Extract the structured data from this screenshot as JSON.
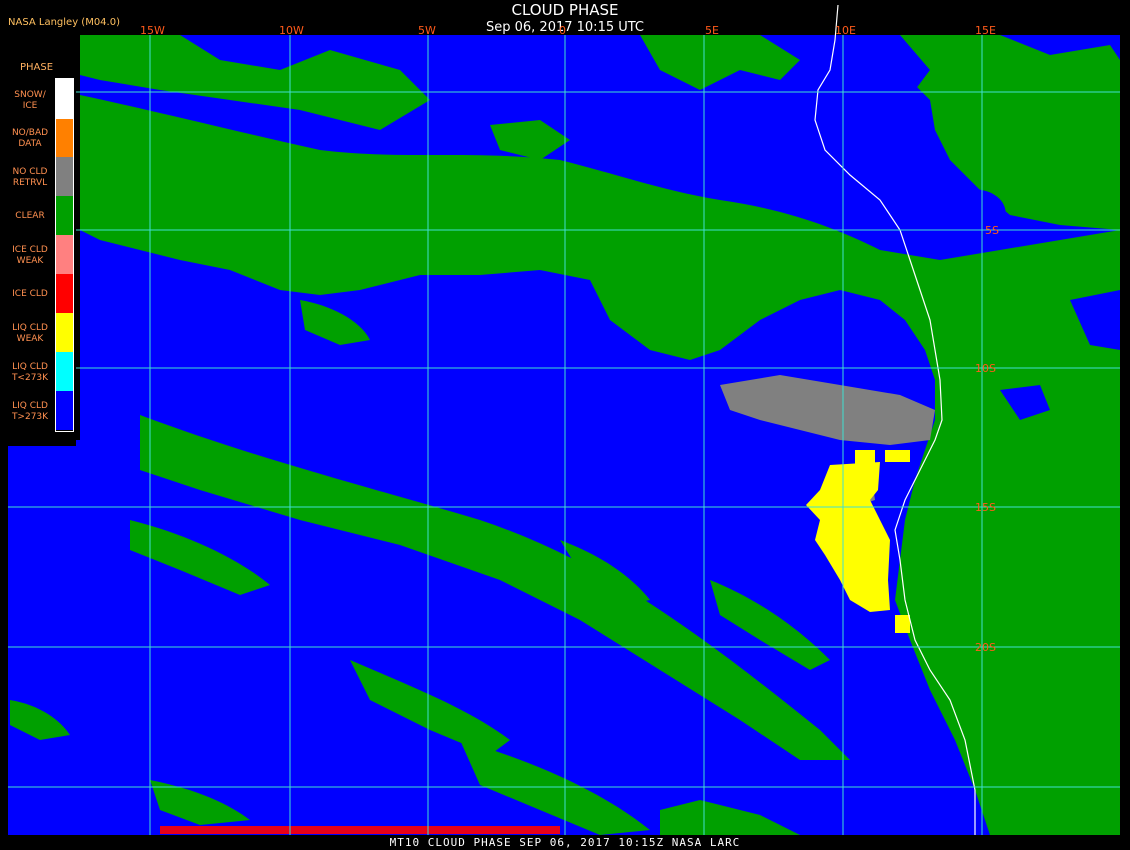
{
  "header": {
    "provider": "NASA Langley (M04.0)",
    "title": "CLOUD PHASE",
    "subtitle": "Sep 06, 2017 10:15 UTC"
  },
  "footer": "MT10  CLOUD PHASE  SEP 06, 2017 10:15Z  NASA LARC",
  "legend": {
    "title": "PHASE",
    "items": [
      {
        "line1": "SNOW/",
        "line2": "ICE",
        "color": "#ffffff"
      },
      {
        "line1": "NO/BAD",
        "line2": "DATA",
        "color": "#ff8000"
      },
      {
        "line1": "NO CLD",
        "line2": "RETRVL",
        "color": "#808080"
      },
      {
        "line1": "CLEAR",
        "line2": "",
        "color": "#00a000"
      },
      {
        "line1": "ICE CLD",
        "line2": "WEAK",
        "color": "#ff8080"
      },
      {
        "line1": "ICE CLD",
        "line2": "",
        "color": "#ff0000"
      },
      {
        "line1": "LIQ CLD",
        "line2": "WEAK",
        "color": "#ffff00"
      },
      {
        "line1": "LIQ CLD",
        "line2": "T<273K",
        "color": "#00ffff"
      },
      {
        "line1": "LIQ CLD",
        "line2": "T>273K",
        "color": "#0000ff"
      }
    ]
  },
  "grid": {
    "longitudes": [
      "15W",
      "10W",
      "5W",
      "0",
      "5E",
      "10E",
      "15E"
    ],
    "latitudes": [
      "5S",
      "10S",
      "15S",
      "20S"
    ],
    "color": "#40e0d0"
  },
  "colors": {
    "ocean_cloud": "#0000ff",
    "clear": "#00a000",
    "liquid_weak": "#ffff00",
    "no_retrieval": "#808080",
    "coastline": "#ffffff"
  }
}
